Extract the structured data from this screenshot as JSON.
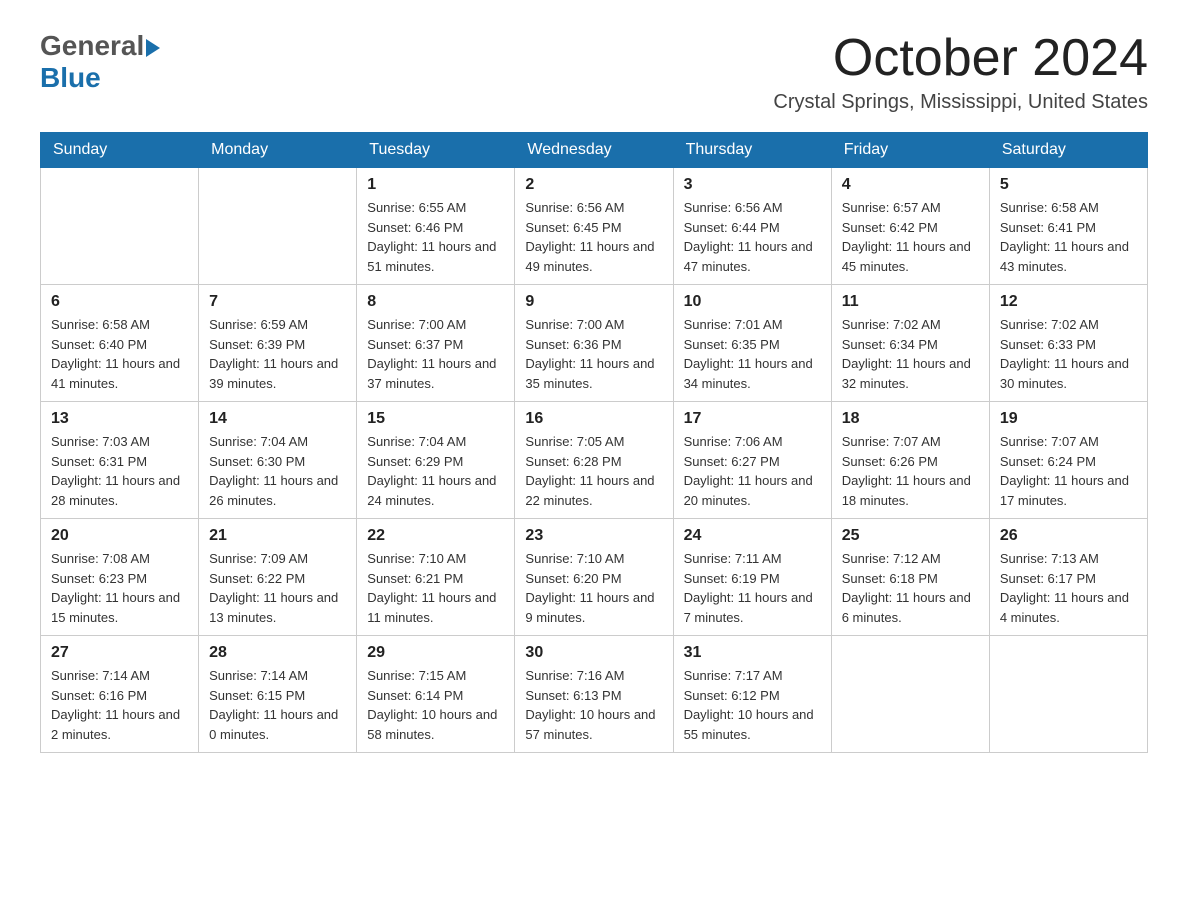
{
  "header": {
    "logo_general": "General",
    "logo_blue": "Blue",
    "month_title": "October 2024",
    "location": "Crystal Springs, Mississippi, United States"
  },
  "days_of_week": [
    "Sunday",
    "Monday",
    "Tuesday",
    "Wednesday",
    "Thursday",
    "Friday",
    "Saturday"
  ],
  "weeks": [
    [
      {
        "num": "",
        "sunrise": "",
        "sunset": "",
        "daylight": ""
      },
      {
        "num": "",
        "sunrise": "",
        "sunset": "",
        "daylight": ""
      },
      {
        "num": "1",
        "sunrise": "Sunrise: 6:55 AM",
        "sunset": "Sunset: 6:46 PM",
        "daylight": "Daylight: 11 hours and 51 minutes."
      },
      {
        "num": "2",
        "sunrise": "Sunrise: 6:56 AM",
        "sunset": "Sunset: 6:45 PM",
        "daylight": "Daylight: 11 hours and 49 minutes."
      },
      {
        "num": "3",
        "sunrise": "Sunrise: 6:56 AM",
        "sunset": "Sunset: 6:44 PM",
        "daylight": "Daylight: 11 hours and 47 minutes."
      },
      {
        "num": "4",
        "sunrise": "Sunrise: 6:57 AM",
        "sunset": "Sunset: 6:42 PM",
        "daylight": "Daylight: 11 hours and 45 minutes."
      },
      {
        "num": "5",
        "sunrise": "Sunrise: 6:58 AM",
        "sunset": "Sunset: 6:41 PM",
        "daylight": "Daylight: 11 hours and 43 minutes."
      }
    ],
    [
      {
        "num": "6",
        "sunrise": "Sunrise: 6:58 AM",
        "sunset": "Sunset: 6:40 PM",
        "daylight": "Daylight: 11 hours and 41 minutes."
      },
      {
        "num": "7",
        "sunrise": "Sunrise: 6:59 AM",
        "sunset": "Sunset: 6:39 PM",
        "daylight": "Daylight: 11 hours and 39 minutes."
      },
      {
        "num": "8",
        "sunrise": "Sunrise: 7:00 AM",
        "sunset": "Sunset: 6:37 PM",
        "daylight": "Daylight: 11 hours and 37 minutes."
      },
      {
        "num": "9",
        "sunrise": "Sunrise: 7:00 AM",
        "sunset": "Sunset: 6:36 PM",
        "daylight": "Daylight: 11 hours and 35 minutes."
      },
      {
        "num": "10",
        "sunrise": "Sunrise: 7:01 AM",
        "sunset": "Sunset: 6:35 PM",
        "daylight": "Daylight: 11 hours and 34 minutes."
      },
      {
        "num": "11",
        "sunrise": "Sunrise: 7:02 AM",
        "sunset": "Sunset: 6:34 PM",
        "daylight": "Daylight: 11 hours and 32 minutes."
      },
      {
        "num": "12",
        "sunrise": "Sunrise: 7:02 AM",
        "sunset": "Sunset: 6:33 PM",
        "daylight": "Daylight: 11 hours and 30 minutes."
      }
    ],
    [
      {
        "num": "13",
        "sunrise": "Sunrise: 7:03 AM",
        "sunset": "Sunset: 6:31 PM",
        "daylight": "Daylight: 11 hours and 28 minutes."
      },
      {
        "num": "14",
        "sunrise": "Sunrise: 7:04 AM",
        "sunset": "Sunset: 6:30 PM",
        "daylight": "Daylight: 11 hours and 26 minutes."
      },
      {
        "num": "15",
        "sunrise": "Sunrise: 7:04 AM",
        "sunset": "Sunset: 6:29 PM",
        "daylight": "Daylight: 11 hours and 24 minutes."
      },
      {
        "num": "16",
        "sunrise": "Sunrise: 7:05 AM",
        "sunset": "Sunset: 6:28 PM",
        "daylight": "Daylight: 11 hours and 22 minutes."
      },
      {
        "num": "17",
        "sunrise": "Sunrise: 7:06 AM",
        "sunset": "Sunset: 6:27 PM",
        "daylight": "Daylight: 11 hours and 20 minutes."
      },
      {
        "num": "18",
        "sunrise": "Sunrise: 7:07 AM",
        "sunset": "Sunset: 6:26 PM",
        "daylight": "Daylight: 11 hours and 18 minutes."
      },
      {
        "num": "19",
        "sunrise": "Sunrise: 7:07 AM",
        "sunset": "Sunset: 6:24 PM",
        "daylight": "Daylight: 11 hours and 17 minutes."
      }
    ],
    [
      {
        "num": "20",
        "sunrise": "Sunrise: 7:08 AM",
        "sunset": "Sunset: 6:23 PM",
        "daylight": "Daylight: 11 hours and 15 minutes."
      },
      {
        "num": "21",
        "sunrise": "Sunrise: 7:09 AM",
        "sunset": "Sunset: 6:22 PM",
        "daylight": "Daylight: 11 hours and 13 minutes."
      },
      {
        "num": "22",
        "sunrise": "Sunrise: 7:10 AM",
        "sunset": "Sunset: 6:21 PM",
        "daylight": "Daylight: 11 hours and 11 minutes."
      },
      {
        "num": "23",
        "sunrise": "Sunrise: 7:10 AM",
        "sunset": "Sunset: 6:20 PM",
        "daylight": "Daylight: 11 hours and 9 minutes."
      },
      {
        "num": "24",
        "sunrise": "Sunrise: 7:11 AM",
        "sunset": "Sunset: 6:19 PM",
        "daylight": "Daylight: 11 hours and 7 minutes."
      },
      {
        "num": "25",
        "sunrise": "Sunrise: 7:12 AM",
        "sunset": "Sunset: 6:18 PM",
        "daylight": "Daylight: 11 hours and 6 minutes."
      },
      {
        "num": "26",
        "sunrise": "Sunrise: 7:13 AM",
        "sunset": "Sunset: 6:17 PM",
        "daylight": "Daylight: 11 hours and 4 minutes."
      }
    ],
    [
      {
        "num": "27",
        "sunrise": "Sunrise: 7:14 AM",
        "sunset": "Sunset: 6:16 PM",
        "daylight": "Daylight: 11 hours and 2 minutes."
      },
      {
        "num": "28",
        "sunrise": "Sunrise: 7:14 AM",
        "sunset": "Sunset: 6:15 PM",
        "daylight": "Daylight: 11 hours and 0 minutes."
      },
      {
        "num": "29",
        "sunrise": "Sunrise: 7:15 AM",
        "sunset": "Sunset: 6:14 PM",
        "daylight": "Daylight: 10 hours and 58 minutes."
      },
      {
        "num": "30",
        "sunrise": "Sunrise: 7:16 AM",
        "sunset": "Sunset: 6:13 PM",
        "daylight": "Daylight: 10 hours and 57 minutes."
      },
      {
        "num": "31",
        "sunrise": "Sunrise: 7:17 AM",
        "sunset": "Sunset: 6:12 PM",
        "daylight": "Daylight: 10 hours and 55 minutes."
      },
      {
        "num": "",
        "sunrise": "",
        "sunset": "",
        "daylight": ""
      },
      {
        "num": "",
        "sunrise": "",
        "sunset": "",
        "daylight": ""
      }
    ]
  ]
}
